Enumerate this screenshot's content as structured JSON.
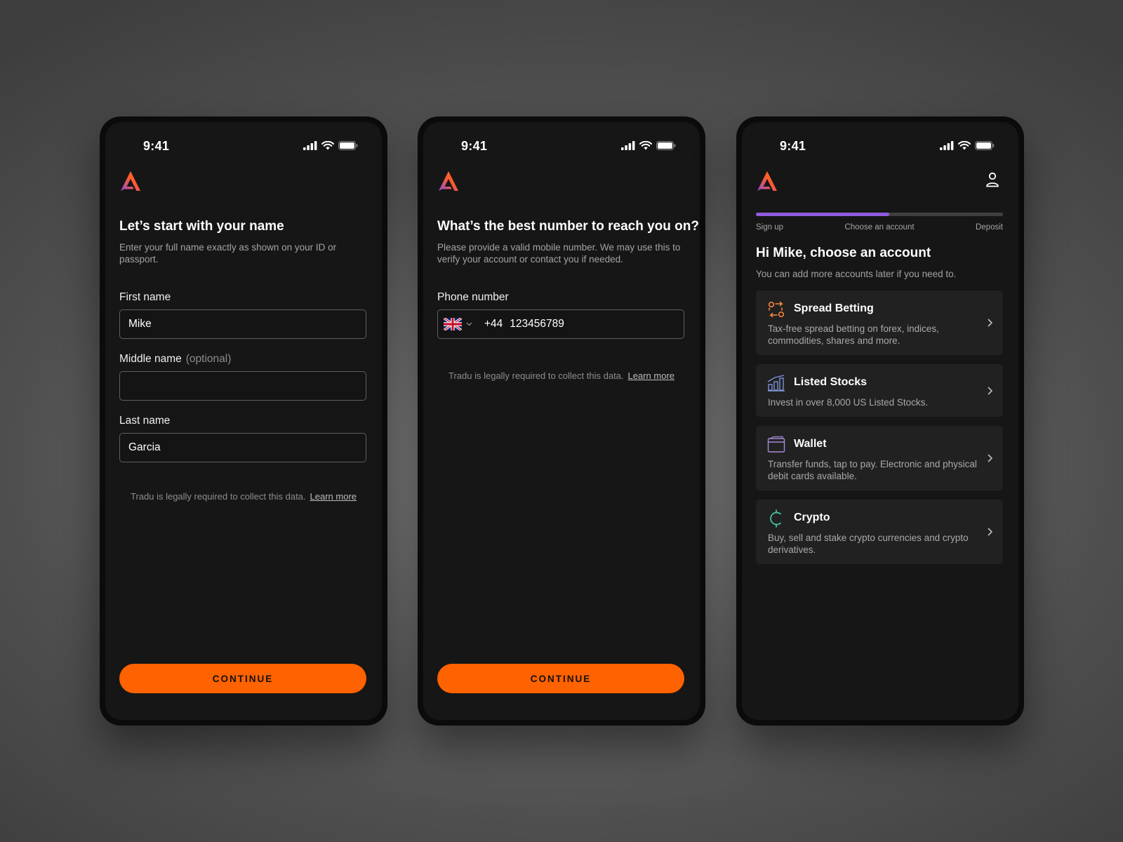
{
  "status_bar": {
    "time": "9:41"
  },
  "colors": {
    "accent": "#ff6200",
    "progress": "#8f5ce0",
    "background": "#161616",
    "card": "#212121"
  },
  "screens": [
    {
      "title": "Let’s start with your name",
      "subtitle": "Enter your full name exactly as shown on your ID or passport.",
      "fields": [
        {
          "label": "First name",
          "value": "Mike"
        },
        {
          "label": "Middle name",
          "optional_tag": "(optional)",
          "value": ""
        },
        {
          "label": "Last name",
          "value": "Garcia"
        }
      ],
      "legal_text": "Tradu is legally required to collect this data.",
      "legal_link": "Learn more",
      "cta_label": "CONTINUE"
    },
    {
      "title": "What’s the best number to reach you on?",
      "subtitle": "Please provide a valid mobile number. We may use this to verify your account or contact you if needed.",
      "phone_label": "Phone number",
      "country_flag_icon": "uk-flag-icon",
      "dial_code": "+44",
      "phone_value": "123456789",
      "legal_text": "Tradu is legally required to collect this data.",
      "legal_link": "Learn more",
      "cta_label": "CONTINUE"
    },
    {
      "progress": {
        "fraction": 0.54,
        "steps": [
          "Sign up",
          "Choose an account",
          "Deposit"
        ]
      },
      "title": "Hi Mike, choose an account",
      "subtitle": "You can add more accounts later if you need to.",
      "accounts": [
        {
          "icon": "spread-betting-icon",
          "color": "#ff8a3d",
          "title": "Spread Betting",
          "description": "Tax-free spread betting on forex, indices, commodities, shares and more."
        },
        {
          "icon": "listed-stocks-icon",
          "color": "#7f93d8",
          "title": "Listed Stocks",
          "description": "Invest in over 8,000 US Listed Stocks."
        },
        {
          "icon": "wallet-icon",
          "color": "#a58bd8",
          "title": "Wallet",
          "description": "Transfer funds, tap to pay. Electronic and physical debit cards available."
        },
        {
          "icon": "crypto-icon",
          "color": "#49c6a5",
          "title": "Crypto",
          "description": "Buy, sell and stake crypto currencies and crypto derivatives."
        }
      ]
    }
  ]
}
